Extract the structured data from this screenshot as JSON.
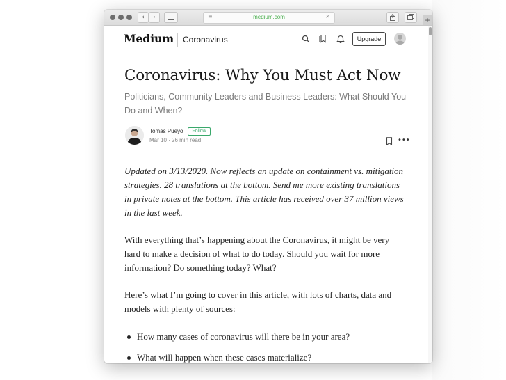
{
  "browser": {
    "url": "medium.com",
    "back_glyph": "‹",
    "forward_glyph": "›",
    "new_tab_glyph": "+"
  },
  "header": {
    "logo": "Medium",
    "publication": "Coronavirus",
    "upgrade_label": "Upgrade"
  },
  "article": {
    "title": "Coronavirus: Why You Must Act Now",
    "subtitle": "Politicians, Community Leaders and Business Leaders: What Should You Do and When?",
    "author": "Tomas Pueyo",
    "follow_label": "Follow",
    "meta": "Mar 10 · 26 min read",
    "more_glyph": "•••",
    "update_note": "Updated on 3/13/2020. Now reflects an update on containment vs. mitigation strategies. 28 translations at the bottom. Send me more existing translations in private notes at the bottom. This article has received over 37 million views in the last week.",
    "para1": "With everything that’s happening about the Coronavirus, it might be very hard to make a decision of what to do today. Should you wait for more information? Do something today? What?",
    "para2": "Here’s what I’m going to cover in this article, with lots of charts, data and models with plenty of sources:",
    "bullets": [
      "How many cases of coronavirus will there be in your area?",
      "What will happen when these cases materialize?"
    ]
  },
  "colors": {
    "accent_green": "#3aa86b",
    "text": "#242424",
    "subtitle": "#7a7a7a"
  },
  "icons": [
    "search-icon",
    "bookmarks-icon",
    "bell-icon",
    "avatar-icon",
    "share-icon",
    "tabs-icon",
    "sidebar-icon",
    "bookmark-icon",
    "more-icon"
  ]
}
